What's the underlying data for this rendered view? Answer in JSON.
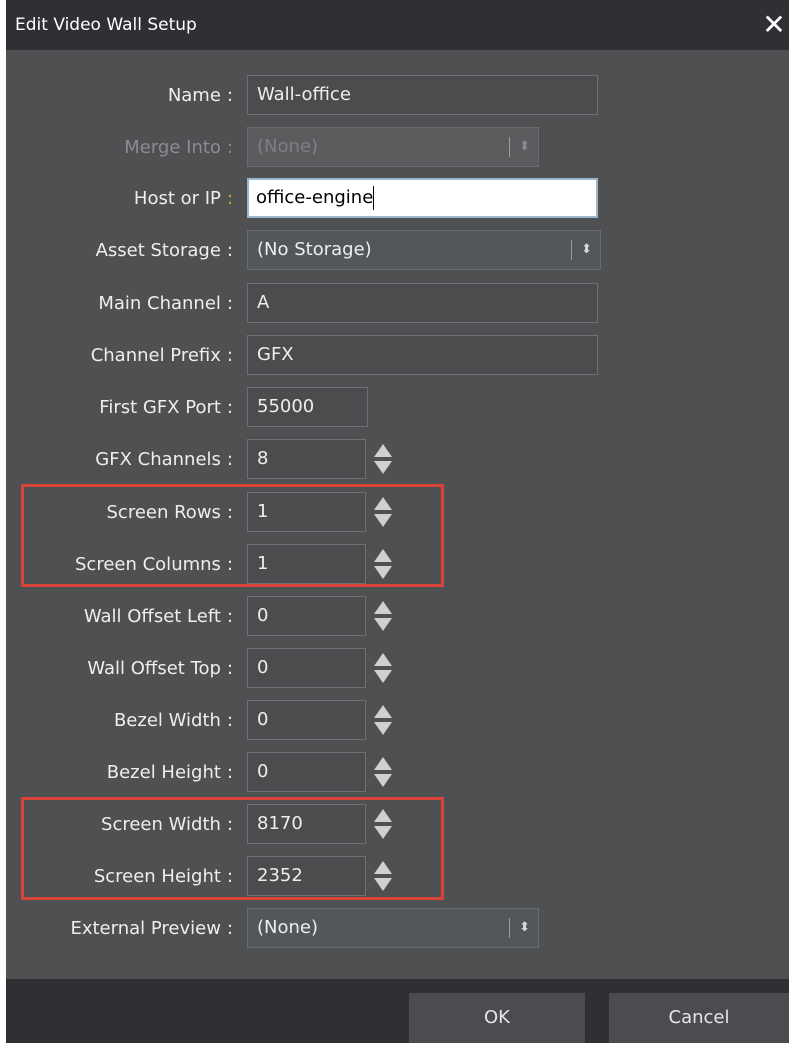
{
  "dialog": {
    "title": "Edit Video Wall Setup",
    "close_glyph": "✕"
  },
  "fields": {
    "name": {
      "label": "Name",
      "value": "Wall-office"
    },
    "merge_into": {
      "label": "Merge Into",
      "value": "(None)",
      "disabled": true
    },
    "host_or_ip": {
      "label": "Host or IP",
      "value": "office-engine"
    },
    "asset_storage": {
      "label": "Asset Storage",
      "value": "(No Storage)"
    },
    "main_channel": {
      "label": "Main Channel",
      "value": "A"
    },
    "channel_prefix": {
      "label": "Channel Prefix",
      "value": "GFX"
    },
    "first_gfx_port": {
      "label": "First GFX Port",
      "value": "55000"
    },
    "gfx_channels": {
      "label": "GFX Channels",
      "value": "8"
    },
    "screen_rows": {
      "label": "Screen Rows",
      "value": "1"
    },
    "screen_columns": {
      "label": "Screen Columns",
      "value": "1"
    },
    "wall_offset_left": {
      "label": "Wall Offset Left",
      "value": "0"
    },
    "wall_offset_top": {
      "label": "Wall Offset Top",
      "value": "0"
    },
    "bezel_width": {
      "label": "Bezel Width",
      "value": "0"
    },
    "bezel_height": {
      "label": "Bezel Height",
      "value": "0"
    },
    "screen_width": {
      "label": "Screen Width",
      "value": "8170"
    },
    "screen_height": {
      "label": "Screen Height",
      "value": "2352"
    },
    "external_preview": {
      "label": "External Preview",
      "value": "(None)"
    }
  },
  "colon": ":",
  "select_arrows": "▲▼",
  "buttons": {
    "ok": "OK",
    "cancel": "Cancel"
  },
  "colors": {
    "dialog_bg": "#4e5052",
    "titlebar_bg": "#2e3033",
    "highlight": "#d9433a",
    "active_colon": "#e0a030"
  }
}
